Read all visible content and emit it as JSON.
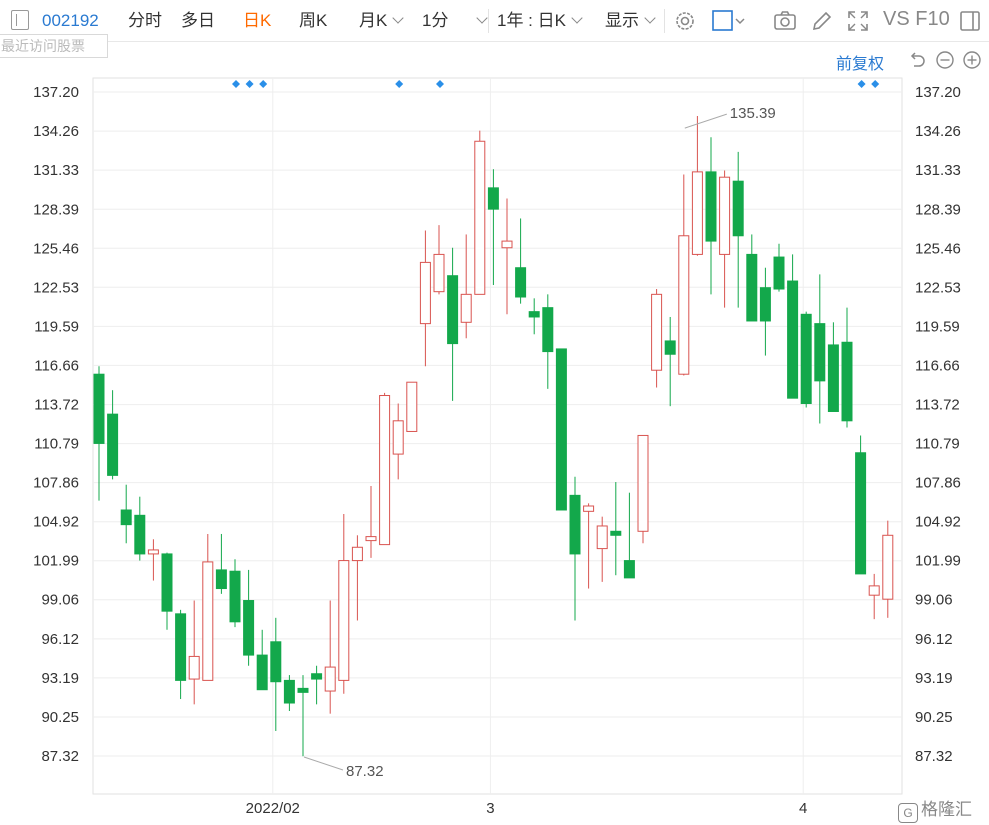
{
  "toolbar": {
    "code": "002192",
    "items": [
      "分时",
      "多日",
      "日K",
      "周K",
      "月K",
      "1分",
      "1年 : 日K",
      "显示"
    ],
    "active": "日K",
    "right_text": "VS F10"
  },
  "recent_visits": "最近访问股票",
  "adjust_label": "前复权",
  "brand": "格隆汇",
  "colors": {
    "up": "#d9534f",
    "down": "#13a84b",
    "grid": "#eeeeee",
    "axis_text": "#333333",
    "accent": "#2a7ad1"
  },
  "icons": [
    "panel-toggle-icon",
    "gear-icon",
    "square-checkbox-icon",
    "camera-icon",
    "pencil-icon",
    "fullscreen-icon",
    "sidebar-icon",
    "undo-icon",
    "zoom-out-icon",
    "zoom-in-icon"
  ],
  "chart_data": {
    "type": "candlestick",
    "yticks": [
      "137.20",
      "134.26",
      "131.33",
      "128.39",
      "125.46",
      "122.53",
      "119.59",
      "116.66",
      "113.72",
      "110.79",
      "107.86",
      "104.92",
      "101.99",
      "99.06",
      "96.12",
      "93.19",
      "90.25",
      "87.32"
    ],
    "ylim": [
      85.6,
      138.6
    ],
    "xlabels": [
      {
        "label": "2022/02",
        "index": 13
      },
      {
        "label": "3",
        "index": 29
      },
      {
        "label": "4",
        "index": 52
      }
    ],
    "annotations": [
      {
        "label": "135.39",
        "index": 43,
        "value": 135.39
      },
      {
        "label": "87.32",
        "index": 15,
        "value": 87.32
      }
    ],
    "event_markers": [
      10,
      11,
      12,
      22,
      25,
      56,
      57
    ],
    "candles": [
      {
        "o": 116.0,
        "h": 116.6,
        "l": 106.5,
        "c": 110.8
      },
      {
        "o": 113.0,
        "h": 114.8,
        "l": 108.1,
        "c": 108.4
      },
      {
        "o": 105.8,
        "h": 107.7,
        "l": 103.3,
        "c": 104.7
      },
      {
        "o": 105.4,
        "h": 106.8,
        "l": 102.0,
        "c": 102.5
      },
      {
        "o": 102.5,
        "h": 103.6,
        "l": 100.5,
        "c": 102.8
      },
      {
        "o": 102.5,
        "h": 102.6,
        "l": 96.8,
        "c": 98.2
      },
      {
        "o": 98.0,
        "h": 98.3,
        "l": 91.6,
        "c": 93.0
      },
      {
        "o": 93.1,
        "h": 99.0,
        "l": 91.2,
        "c": 94.8
      },
      {
        "o": 93.0,
        "h": 104.0,
        "l": 93.0,
        "c": 101.9
      },
      {
        "o": 101.3,
        "h": 104.0,
        "l": 99.5,
        "c": 99.9
      },
      {
        "o": 101.2,
        "h": 102.1,
        "l": 97.0,
        "c": 97.4
      },
      {
        "o": 99.0,
        "h": 101.3,
        "l": 94.1,
        "c": 94.9
      },
      {
        "o": 94.9,
        "h": 96.8,
        "l": 92.8,
        "c": 92.3
      },
      {
        "o": 95.9,
        "h": 97.7,
        "l": 89.2,
        "c": 92.9
      },
      {
        "o": 93.0,
        "h": 93.4,
        "l": 90.7,
        "c": 91.3
      },
      {
        "o": 92.4,
        "h": 93.4,
        "l": 87.3,
        "c": 92.1
      },
      {
        "o": 93.5,
        "h": 94.1,
        "l": 91.2,
        "c": 93.1
      },
      {
        "o": 92.2,
        "h": 99.0,
        "l": 90.5,
        "c": 94.0
      },
      {
        "o": 93.0,
        "h": 105.5,
        "l": 92.0,
        "c": 102.0
      },
      {
        "o": 102.0,
        "h": 103.9,
        "l": 97.5,
        "c": 103.0
      },
      {
        "o": 103.5,
        "h": 107.6,
        "l": 102.2,
        "c": 103.8
      },
      {
        "o": 103.2,
        "h": 114.6,
        "l": 103.2,
        "c": 114.4
      },
      {
        "o": 110.0,
        "h": 113.8,
        "l": 108.1,
        "c": 112.5
      },
      {
        "o": 111.7,
        "h": 114.8,
        "l": 111.7,
        "c": 115.4
      },
      {
        "o": 119.8,
        "h": 126.8,
        "l": 116.6,
        "c": 124.4
      },
      {
        "o": 122.2,
        "h": 127.2,
        "l": 122.0,
        "c": 125.0
      },
      {
        "o": 123.4,
        "h": 125.5,
        "l": 114.0,
        "c": 118.3
      },
      {
        "o": 119.9,
        "h": 126.5,
        "l": 118.7,
        "c": 122.0
      },
      {
        "o": 122.0,
        "h": 134.3,
        "l": 122.0,
        "c": 133.5
      },
      {
        "o": 130.0,
        "h": 131.4,
        "l": 122.7,
        "c": 128.4
      },
      {
        "o": 125.5,
        "h": 129.2,
        "l": 120.5,
        "c": 126.0
      },
      {
        "o": 124.0,
        "h": 127.7,
        "l": 121.3,
        "c": 121.8
      },
      {
        "o": 120.7,
        "h": 121.7,
        "l": 119.0,
        "c": 120.3
      },
      {
        "o": 121.0,
        "h": 122.0,
        "l": 114.9,
        "c": 117.7
      },
      {
        "o": 117.9,
        "h": 117.9,
        "l": 105.8,
        "c": 105.8
      },
      {
        "o": 106.9,
        "h": 108.3,
        "l": 97.5,
        "c": 102.5
      },
      {
        "o": 105.7,
        "h": 106.3,
        "l": 99.9,
        "c": 106.1
      },
      {
        "o": 102.9,
        "h": 105.3,
        "l": 100.4,
        "c": 104.6
      },
      {
        "o": 104.2,
        "h": 107.9,
        "l": 100.9,
        "c": 103.9
      },
      {
        "o": 102.0,
        "h": 107.1,
        "l": 100.7,
        "c": 100.7
      },
      {
        "o": 104.2,
        "h": 111.4,
        "l": 103.3,
        "c": 111.4
      },
      {
        "o": 116.3,
        "h": 122.4,
        "l": 115.0,
        "c": 122.0
      },
      {
        "o": 118.5,
        "h": 120.3,
        "l": 113.6,
        "c": 117.5
      },
      {
        "o": 116.0,
        "h": 131.0,
        "l": 115.9,
        "c": 126.4
      },
      {
        "o": 125.0,
        "h": 135.4,
        "l": 124.9,
        "c": 131.2
      },
      {
        "o": 131.2,
        "h": 133.8,
        "l": 122.0,
        "c": 126.0
      },
      {
        "o": 125.0,
        "h": 131.3,
        "l": 121.0,
        "c": 130.8
      },
      {
        "o": 130.5,
        "h": 132.7,
        "l": 121.0,
        "c": 126.4
      },
      {
        "o": 125.0,
        "h": 126.5,
        "l": 120.0,
        "c": 120.0
      },
      {
        "o": 122.5,
        "h": 124.0,
        "l": 117.4,
        "c": 120.0
      },
      {
        "o": 124.8,
        "h": 125.8,
        "l": 122.2,
        "c": 122.4
      },
      {
        "o": 123.0,
        "h": 125.0,
        "l": 114.2,
        "c": 114.2
      },
      {
        "o": 120.5,
        "h": 120.7,
        "l": 113.5,
        "c": 113.8
      },
      {
        "o": 119.8,
        "h": 123.5,
        "l": 112.3,
        "c": 115.5
      },
      {
        "o": 118.2,
        "h": 119.9,
        "l": 113.3,
        "c": 113.2
      },
      {
        "o": 118.4,
        "h": 121.0,
        "l": 112.0,
        "c": 112.5
      },
      {
        "o": 110.1,
        "h": 111.4,
        "l": 101.0,
        "c": 101.0
      },
      {
        "o": 99.4,
        "h": 101.0,
        "l": 97.6,
        "c": 100.1
      },
      {
        "o": 99.1,
        "h": 105.0,
        "l": 97.7,
        "c": 103.9
      }
    ]
  }
}
